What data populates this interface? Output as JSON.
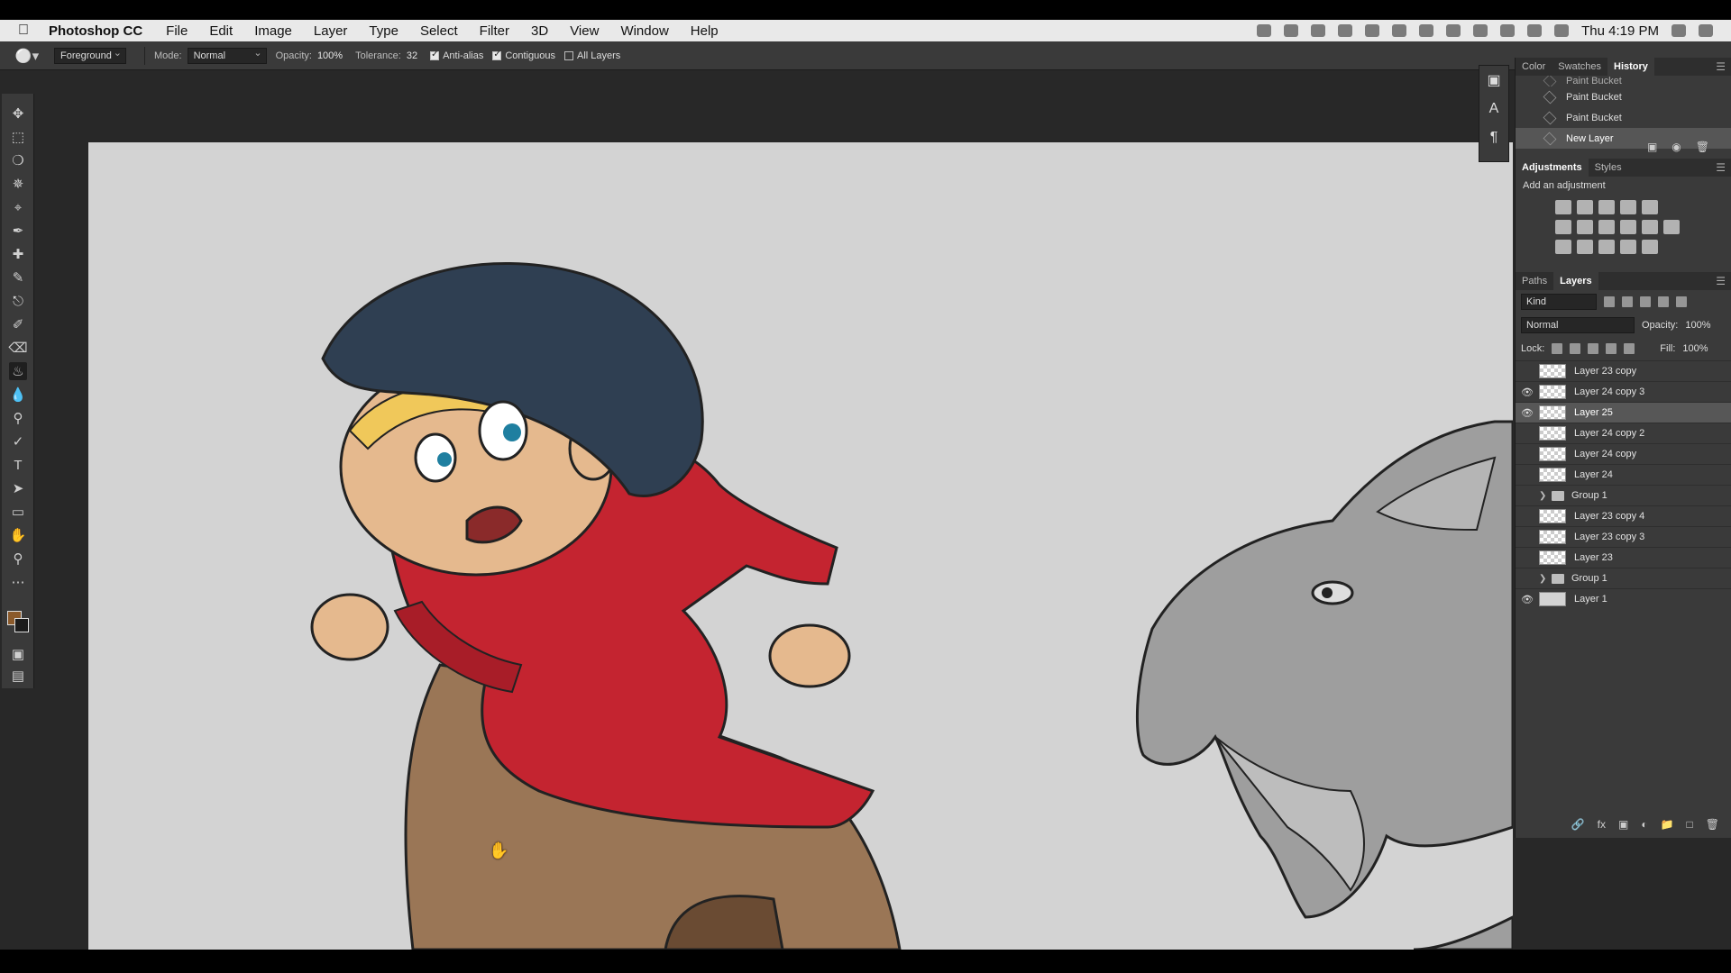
{
  "menubar": {
    "app": "Photoshop CC",
    "items": [
      "File",
      "Edit",
      "Image",
      "Layer",
      "Type",
      "Select",
      "Filter",
      "3D",
      "View",
      "Window",
      "Help"
    ],
    "clock": "Thu 4:19 PM"
  },
  "options": {
    "fill_source": "Foreground",
    "mode_label": "Mode:",
    "mode_value": "Normal",
    "opacity_label": "Opacity:",
    "opacity_value": "100%",
    "tolerance_label": "Tolerance:",
    "tolerance_value": "32",
    "antialias": "Anti-alias",
    "contiguous": "Contiguous",
    "all_layers": "All Layers"
  },
  "history_panel": {
    "tabs": [
      "Color",
      "Swatches",
      "History"
    ],
    "active_tab": "History",
    "states": [
      "Paint Bucket",
      "Paint Bucket",
      "Paint Bucket",
      "New Layer"
    ],
    "selected_state": "New Layer"
  },
  "adjustments_panel": {
    "tabs": [
      "Adjustments",
      "Styles"
    ],
    "title": "Add an adjustment"
  },
  "layers_panel": {
    "tabs": [
      "Paths",
      "Layers"
    ],
    "kind": "Kind",
    "blend_mode": "Normal",
    "opacity_label": "Opacity:",
    "opacity_value": "100%",
    "lock_label": "Lock:",
    "fill_label": "Fill:",
    "fill_value": "100%",
    "layers": [
      {
        "name": "Layer 23 copy",
        "visible": false,
        "type": "layer"
      },
      {
        "name": "Layer 24 copy 3",
        "visible": true,
        "type": "layer"
      },
      {
        "name": "Layer 25",
        "visible": true,
        "type": "layer",
        "selected": true
      },
      {
        "name": "Layer 24 copy 2",
        "visible": false,
        "type": "layer"
      },
      {
        "name": "Layer 24 copy",
        "visible": false,
        "type": "layer"
      },
      {
        "name": "Layer 24",
        "visible": false,
        "type": "layer"
      },
      {
        "name": "Group 1",
        "visible": false,
        "type": "group"
      },
      {
        "name": "Layer 23 copy 4",
        "visible": false,
        "type": "layer"
      },
      {
        "name": "Layer 23 copy 3",
        "visible": false,
        "type": "layer"
      },
      {
        "name": "Layer 23",
        "visible": false,
        "type": "layer"
      },
      {
        "name": "Group 1",
        "visible": false,
        "type": "group"
      },
      {
        "name": "Layer 1",
        "visible": true,
        "type": "layer",
        "solid": true
      }
    ]
  },
  "colors": {
    "foreground": "#8b5a2b",
    "background": "#1c1c1c",
    "canvas_bg": "#d3d3d3"
  }
}
